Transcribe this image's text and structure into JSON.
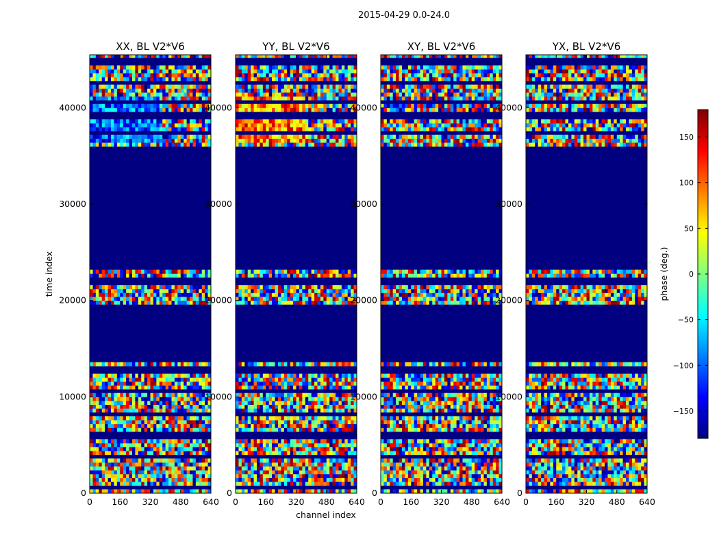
{
  "chart_data": {
    "type": "heatmap",
    "suptitle": "2015-04-29 0.0-24.0",
    "xlabel": "channel index",
    "ylabel": "time index",
    "xlim": [
      0,
      640
    ],
    "ylim": [
      0,
      45500
    ],
    "xticks": [
      0,
      160,
      320,
      480,
      640
    ],
    "yticks": [
      0,
      10000,
      20000,
      30000,
      40000
    ],
    "colorbar": {
      "label": "phase (deg.)",
      "range": [
        -180,
        180
      ],
      "ticks": [
        150,
        100,
        50,
        0,
        -50,
        -100,
        -150
      ],
      "ticklabels": [
        "150",
        "100",
        "50",
        "0",
        "−50",
        "−100",
        "−150"
      ],
      "colormap": [
        "#000080",
        "#0000ff",
        "#0080ff",
        "#00ffff",
        "#80ff80",
        "#ffff00",
        "#ff8000",
        "#ff0000",
        "#800000"
      ]
    },
    "panels": [
      {
        "title": "XX, BL V2*V6",
        "polarization": "XX"
      },
      {
        "title": "YY, BL V2*V6",
        "polarization": "YY"
      },
      {
        "title": "XY, BL V2*V6",
        "polarization": "XY"
      },
      {
        "title": "YX, BL V2*V6",
        "polarization": "YX"
      }
    ],
    "flagged_value": -180,
    "flagged_bands": [
      [
        600,
        700
      ],
      [
        3700,
        3800
      ],
      [
        5900,
        6100
      ],
      [
        8000,
        8100
      ],
      [
        10500,
        10800
      ],
      [
        12500,
        13000
      ],
      [
        13700,
        14300
      ],
      [
        14300,
        18500
      ],
      [
        18800,
        19500
      ],
      [
        21600,
        22300
      ],
      [
        23300,
        31800
      ],
      [
        32300,
        35800
      ],
      [
        37300,
        37600
      ],
      [
        39000,
        39300
      ],
      [
        40500,
        40700
      ],
      [
        42500,
        42800
      ],
      [
        44600,
        44900
      ]
    ]
  }
}
